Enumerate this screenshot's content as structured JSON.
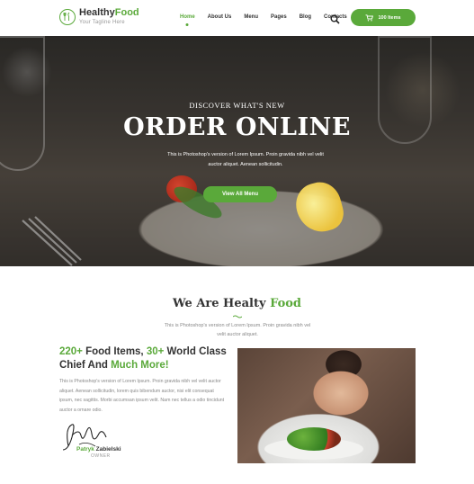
{
  "header": {
    "logo": {
      "name_part1": "Healthy",
      "name_part2": "Food",
      "tagline": "Your Tagline Here"
    },
    "nav": [
      "Home",
      "About Us",
      "Menu",
      "Pages",
      "Blog",
      "Contacts"
    ],
    "active_nav": "Home",
    "search_icon": "search-icon",
    "cart": {
      "label": "100 Items",
      "icon": "cart-icon"
    }
  },
  "hero": {
    "subtitle": "DISCOVER WHAT'S NEW",
    "title": "ORDER ONLINE",
    "text": "This is Photoshop's version  of Lorem Ipsum. Proin gravida nibh vel velit auctor aliquet. Aenean sollicitudin.",
    "button_label": "View All Menu"
  },
  "intro": {
    "title_part1": "We Are Healty",
    "title_part2": "Food",
    "text": "This is Photoshop's version  of Lorem Ipsum. Proin gravida nibh vel velit auctor aliquet."
  },
  "feature": {
    "h_num1": "220+",
    "h_text1": " Food Items, ",
    "h_num2": "30+",
    "h_text2": " World Class Chief And ",
    "h_highlight": "Much More!",
    "text": "This is Photoshop's version  of Lorem Ipsum. Proin gravida nibh vel velit auctor aliquet. Aenean sollicitudin, lorem quis bibendum auctor, nisi elit consequat ipsum, nec sagittis. Morbi accumsan ipsum velit. Nam nec tellus a odio tincidunt auctor a ornare odio.",
    "signer_first": "Patryk",
    "signer_last": " Zabielski",
    "signer_role": "OWNER"
  },
  "colors": {
    "accent": "#5aa93a",
    "text_dark": "#333333",
    "text_muted": "#888888"
  }
}
